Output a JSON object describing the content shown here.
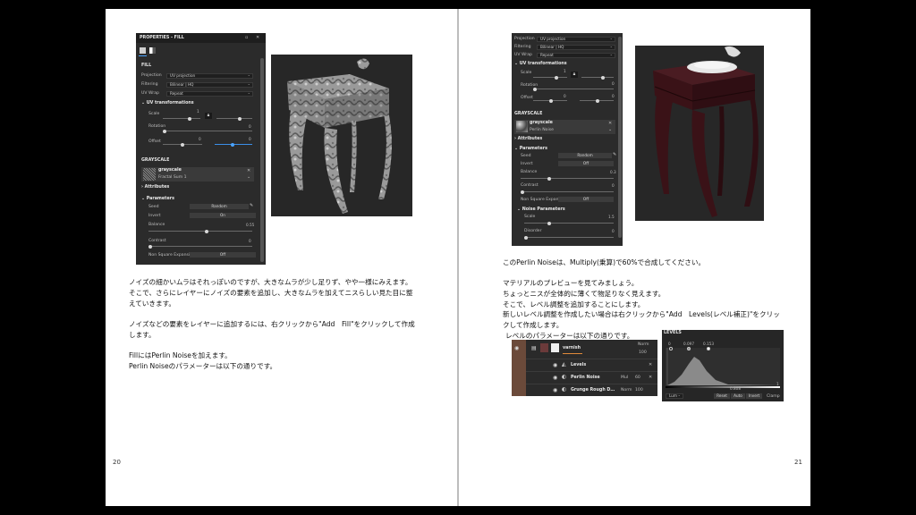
{
  "left": {
    "page_number": "20",
    "panel": {
      "title": "PROPERTIES - FILL",
      "section": "FILL",
      "projection_label": "Projection",
      "projection_value": "UV projection",
      "filtering_label": "Filtering",
      "filtering_value": "Bilinear | HQ",
      "uvwrap_label": "UV Wrap",
      "uvwrap_value": "Repeat",
      "uvtrans": "UV transformations",
      "scale_label": "Scale",
      "scale_value": "1",
      "rotation_label": "Rotation",
      "rotation_value": "0",
      "offset_label": "Offset",
      "offset_value1": "0",
      "offset_value2": "0",
      "grayscale": "GRAYSCALE",
      "gs_item_name": "grayscale",
      "gs_item_sub": "Fractal Sum 1",
      "attributes": "Attributes",
      "parameters": "Parameters",
      "seed_label": "Seed",
      "seed_button": "Random",
      "invert_label": "Invert",
      "invert_button": "On",
      "balance_label": "Balance",
      "balance_value": "0.55",
      "contrast_label": "Contrast",
      "contrast_value": "0",
      "nse_label": "Non Square Expansion",
      "nse_button": "Off"
    },
    "paragraphs": [
      "ノイズの細かいムラはそれっぽいのですが、大きなムラが少し足りず、やや一様にみえます。",
      "そこで、さらにレイヤーにノイズの要素を追加し、大きなムラを加えてニスらしい見た目に整",
      "えていきます。",
      "ノイズなどの要素をレイヤーに追加するには、右クリックから\"Add　Fill\"をクリックして作成",
      "します。",
      "FillにはPerlin Noiseを加えます。",
      "Perlin Noiseのパラメーターは以下の通りです。"
    ]
  },
  "right": {
    "page_number": "21",
    "panel": {
      "projection_label": "Projection",
      "projection_value": "UV projection",
      "filtering_label": "Filtering",
      "filtering_value": "Bilinear | HQ",
      "uvwrap_label": "UV Wrap",
      "uvwrap_value": "Repeat",
      "uvtrans": "UV transformations",
      "scale_label": "Scale",
      "scale_value": "1",
      "rotation_label": "Rotation",
      "rotation_value": "0",
      "offset_label": "Offset",
      "offset_value1": "0",
      "offset_value2": "0",
      "grayscale": "GRAYSCALE",
      "gs_item_name": "grayscale",
      "gs_item_sub": "Perlin Noise",
      "attributes": "Attributes",
      "parameters": "Parameters",
      "seed_label": "Seed",
      "seed_button": "Random",
      "invert_label": "Invert",
      "invert_button": "Off",
      "balance_label": "Balance",
      "balance_value": "0.3",
      "contrast_label": "Contrast",
      "contrast_value": "0",
      "nse_label": "Non Square Expansion",
      "nse_button": "Off",
      "noise_params": "Noise Parameters",
      "scale2_label": "Scale",
      "scale2_value": "1.5",
      "disorder_label": "Disorder",
      "disorder_value": "0"
    },
    "paragraphs": [
      "このPerlin Noiseは、Multiply(乗算)で60%で合成してください。",
      "マテリアルのプレビューを見てみましょう。",
      "ちょっとニスが全体的に薄くて物足りなく見えます。",
      "そこで、レベル調整を追加することにします。",
      "新しいレベル調整を作成したい場合は右クリックから\"Add　Levels(レベル補正)\"をクリッ",
      "クして作成します。",
      "レベルのパラメーターは以下の通りです。"
    ],
    "layers": {
      "top_blend": "Norm",
      "top_opacity": "100",
      "folder_name": "varnish",
      "rows": [
        {
          "name": "Levels",
          "blend": "",
          "opacity": ""
        },
        {
          "name": "Perlin Noise",
          "blend": "Mul",
          "opacity": "60"
        },
        {
          "name": "Grunge Rough D…",
          "blend": "Norm",
          "opacity": "100"
        }
      ]
    },
    "levels": {
      "title": "LEVELS",
      "marker_left": "0",
      "marker_mid": "0.097",
      "marker_right": "0.153",
      "out_mid": "0.808",
      "out_right": "1",
      "mode": "Lum",
      "reset": "Reset",
      "auto": "Auto",
      "invert": "Invert",
      "clamp": "Clamp"
    }
  }
}
